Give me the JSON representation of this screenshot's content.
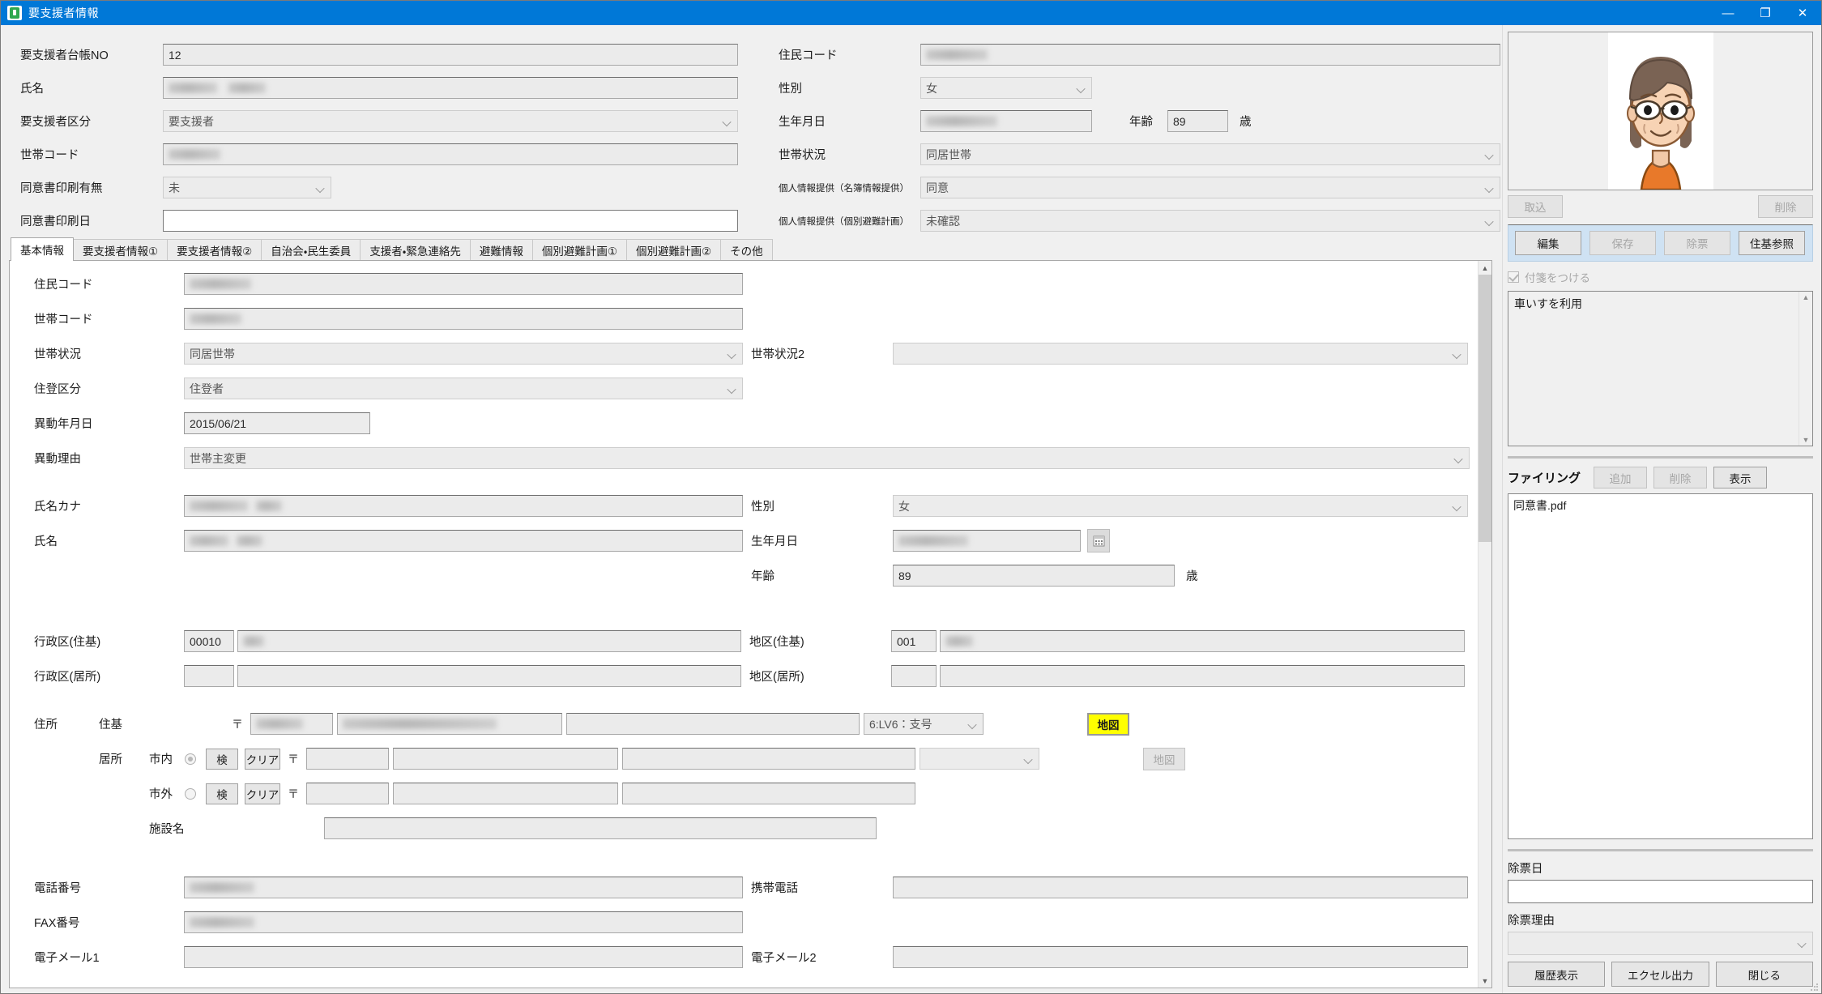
{
  "window": {
    "title": "要支援者情報",
    "icon": "app-icon",
    "minimize": "—",
    "maximize": "❐",
    "close": "✕"
  },
  "header": {
    "left_fields": [
      {
        "label": "要支援者台帳NO",
        "value": "12",
        "type": "text",
        "masked": false
      },
      {
        "label": "氏名",
        "value": "",
        "type": "text",
        "masked": true,
        "mask_w": 120
      },
      {
        "label": "要支援者区分",
        "value": "要支援者",
        "type": "combo",
        "masked": false
      },
      {
        "label": "世帯コード",
        "value": "",
        "type": "text",
        "masked": true,
        "mask_w": 90
      },
      {
        "label": "同意書印刷有無",
        "value": "未",
        "type": "combo-small",
        "masked": false
      },
      {
        "label": "同意書印刷日",
        "value": "",
        "type": "text-white",
        "masked": false
      }
    ],
    "right_fields": [
      {
        "label": "住民コード",
        "value": "",
        "type": "text",
        "masked": true,
        "mask_w": 85
      },
      {
        "label": "性別",
        "value": "女",
        "type": "combo-mid",
        "masked": false
      },
      {
        "label": "生年月日",
        "value": "",
        "type": "date",
        "masked": true,
        "mask_w": 90
      },
      {
        "label": "世帯状況",
        "value": "同居世帯",
        "type": "combo-wide",
        "masked": false
      },
      {
        "label": "個人情報提供（名簿情報提供）",
        "value": "同意",
        "type": "combo-wide",
        "small_label": true
      },
      {
        "label": "個人情報提供（個別避難計画）",
        "value": "未確認",
        "type": "combo-wide",
        "small_label": true
      }
    ],
    "age_label": "年齢",
    "age_value": "89",
    "age_unit": "歳"
  },
  "tabs": [
    {
      "label": "基本情報",
      "active": true
    },
    {
      "label": "要支援者情報①",
      "active": false
    },
    {
      "label": "要支援者情報②",
      "active": false
    },
    {
      "label": "自治会・民生委員",
      "active": false
    },
    {
      "label": "支援者・緊急連絡先",
      "active": false
    },
    {
      "label": "避難情報",
      "active": false
    },
    {
      "label": "個別避難計画①",
      "active": false
    },
    {
      "label": "個別避難計画②",
      "active": false
    },
    {
      "label": "その他",
      "active": false
    }
  ],
  "basic_info": {
    "resident_code": {
      "label": "住民コード",
      "value": "",
      "masked": true,
      "mask_w": 85
    },
    "household_code": {
      "label": "世帯コード",
      "value": "",
      "masked": true,
      "mask_w": 70
    },
    "household_status": {
      "label": "世帯状況",
      "value": "同居世帯"
    },
    "household_status2": {
      "label": "世帯状況2",
      "value": ""
    },
    "resident_class": {
      "label": "住登区分",
      "value": "住登者"
    },
    "change_date": {
      "label": "異動年月日",
      "value": "2015/06/21"
    },
    "change_reason": {
      "label": "異動理由",
      "value": "世帯主変更"
    },
    "name_kana": {
      "label": "氏名カナ",
      "value": "",
      "masked": true,
      "mask_w": 115
    },
    "name": {
      "label": "氏名",
      "value": "",
      "masked": true,
      "mask_w": 105
    },
    "gender": {
      "label": "性別",
      "value": "女"
    },
    "birthdate": {
      "label": "生年月日",
      "value": "",
      "masked": true,
      "mask_w": 85
    },
    "age": {
      "label": "年齢",
      "value": "89",
      "unit": "歳"
    },
    "admin_district_juki": {
      "label": "行政区(住基)",
      "code": "00010",
      "name": "",
      "masked": true,
      "mask_w": 26
    },
    "admin_district_kyosho": {
      "label": "行政区(居所)",
      "code": "",
      "name": ""
    },
    "district_juki": {
      "label": "地区(住基)",
      "code": "001",
      "name": "",
      "masked": true,
      "mask_w": 34
    },
    "district_kyosho": {
      "label": "地区(居所)",
      "code": "",
      "name": ""
    },
    "address": {
      "label": "住所",
      "juki_label": "住基",
      "kyosho_label": "居所",
      "inside_label": "市内",
      "outside_label": "市外",
      "search_button": "検",
      "clear_button": "クリア",
      "postal_mark": "〒",
      "facility_label": "施設名",
      "facility_value": "",
      "juki_zip": "",
      "juki_zip_masked": true,
      "juki_addr": "",
      "juki_addr_masked": true,
      "level_select": "6:LV6：支号",
      "level_select2": "",
      "map_button": "地図",
      "map_button2": "地図",
      "inside_selected": true,
      "outside_selected": false
    },
    "phone": {
      "label": "電話番号",
      "value": "",
      "masked": true,
      "mask_w": 80
    },
    "mobile": {
      "label": "携帯電話",
      "value": ""
    },
    "fax": {
      "label": "FAX番号",
      "value": "",
      "masked": true,
      "mask_w": 80
    },
    "email1": {
      "label": "電子メール1",
      "value": ""
    },
    "email2": {
      "label": "電子メール2",
      "value": ""
    }
  },
  "right_panel": {
    "photo": {
      "name": "person-photo-elderly-woman",
      "alt": ""
    },
    "import_button": {
      "label": "取込",
      "disabled": true
    },
    "photo_delete_button": {
      "label": "削除",
      "disabled": true
    },
    "action_buttons": [
      {
        "label": "編集",
        "disabled": false
      },
      {
        "label": "保存",
        "disabled": true
      },
      {
        "label": "除票",
        "disabled": true
      },
      {
        "label": "住基参照",
        "disabled": false
      }
    ],
    "tag_checkbox": {
      "label": "付箋をつける",
      "checked": true,
      "disabled": true
    },
    "memo": "車いすを利用",
    "filing": {
      "title": "ファイリング",
      "add_button": {
        "label": "追加",
        "disabled": true
      },
      "delete_button": {
        "label": "削除",
        "disabled": true
      },
      "view_button": {
        "label": "表示",
        "disabled": false
      },
      "files": [
        "同意書.pdf"
      ]
    },
    "removal_date": {
      "label": "除票日",
      "value": ""
    },
    "removal_reason": {
      "label": "除票理由",
      "value": ""
    },
    "bottom_buttons": [
      {
        "label": "履歴表示"
      },
      {
        "label": "エクセル出力"
      },
      {
        "label": "閉じる"
      }
    ]
  },
  "colors": {
    "title_bar": "#0078d7",
    "accent_panel": "#cfe2f3",
    "map_highlight": "#ffff00"
  }
}
